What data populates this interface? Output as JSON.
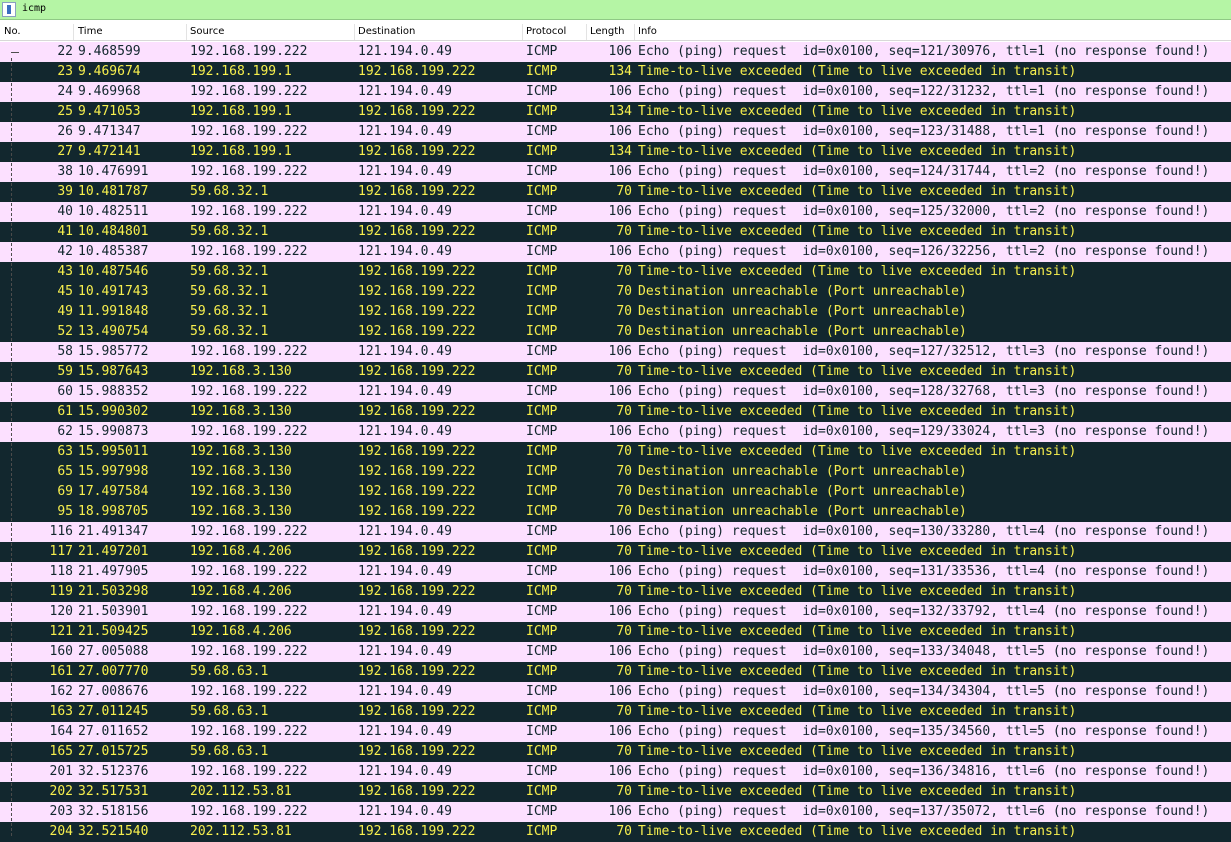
{
  "filter": {
    "value": "icmp"
  },
  "columns": {
    "no": "No.",
    "time": "Time",
    "source": "Source",
    "destination": "Destination",
    "protocol": "Protocol",
    "length": "Length",
    "info": "Info"
  },
  "colors": {
    "request_bg": "#fce0ff",
    "error_bg": "#12272e",
    "error_fg": "#f7ef4e",
    "filter_bg": "#b5f5a5"
  },
  "packets": [
    {
      "no": "22",
      "time": "9.468599",
      "src": "192.168.199.222",
      "dst": "121.194.0.49",
      "proto": "ICMP",
      "len": "106",
      "info": "Echo (ping) request  id=0x0100, seq=121/30976, ttl=1 (no response found!)",
      "kind": "req"
    },
    {
      "no": "23",
      "time": "9.469674",
      "src": "192.168.199.1",
      "dst": "192.168.199.222",
      "proto": "ICMP",
      "len": "134",
      "info": "Time-to-live exceeded (Time to live exceeded in transit)",
      "kind": "err"
    },
    {
      "no": "24",
      "time": "9.469968",
      "src": "192.168.199.222",
      "dst": "121.194.0.49",
      "proto": "ICMP",
      "len": "106",
      "info": "Echo (ping) request  id=0x0100, seq=122/31232, ttl=1 (no response found!)",
      "kind": "req"
    },
    {
      "no": "25",
      "time": "9.471053",
      "src": "192.168.199.1",
      "dst": "192.168.199.222",
      "proto": "ICMP",
      "len": "134",
      "info": "Time-to-live exceeded (Time to live exceeded in transit)",
      "kind": "err"
    },
    {
      "no": "26",
      "time": "9.471347",
      "src": "192.168.199.222",
      "dst": "121.194.0.49",
      "proto": "ICMP",
      "len": "106",
      "info": "Echo (ping) request  id=0x0100, seq=123/31488, ttl=1 (no response found!)",
      "kind": "req"
    },
    {
      "no": "27",
      "time": "9.472141",
      "src": "192.168.199.1",
      "dst": "192.168.199.222",
      "proto": "ICMP",
      "len": "134",
      "info": "Time-to-live exceeded (Time to live exceeded in transit)",
      "kind": "err"
    },
    {
      "no": "38",
      "time": "10.476991",
      "src": "192.168.199.222",
      "dst": "121.194.0.49",
      "proto": "ICMP",
      "len": "106",
      "info": "Echo (ping) request  id=0x0100, seq=124/31744, ttl=2 (no response found!)",
      "kind": "req"
    },
    {
      "no": "39",
      "time": "10.481787",
      "src": "59.68.32.1",
      "dst": "192.168.199.222",
      "proto": "ICMP",
      "len": "70",
      "info": "Time-to-live exceeded (Time to live exceeded in transit)",
      "kind": "err"
    },
    {
      "no": "40",
      "time": "10.482511",
      "src": "192.168.199.222",
      "dst": "121.194.0.49",
      "proto": "ICMP",
      "len": "106",
      "info": "Echo (ping) request  id=0x0100, seq=125/32000, ttl=2 (no response found!)",
      "kind": "req"
    },
    {
      "no": "41",
      "time": "10.484801",
      "src": "59.68.32.1",
      "dst": "192.168.199.222",
      "proto": "ICMP",
      "len": "70",
      "info": "Time-to-live exceeded (Time to live exceeded in transit)",
      "kind": "err"
    },
    {
      "no": "42",
      "time": "10.485387",
      "src": "192.168.199.222",
      "dst": "121.194.0.49",
      "proto": "ICMP",
      "len": "106",
      "info": "Echo (ping) request  id=0x0100, seq=126/32256, ttl=2 (no response found!)",
      "kind": "req"
    },
    {
      "no": "43",
      "time": "10.487546",
      "src": "59.68.32.1",
      "dst": "192.168.199.222",
      "proto": "ICMP",
      "len": "70",
      "info": "Time-to-live exceeded (Time to live exceeded in transit)",
      "kind": "err"
    },
    {
      "no": "45",
      "time": "10.491743",
      "src": "59.68.32.1",
      "dst": "192.168.199.222",
      "proto": "ICMP",
      "len": "70",
      "info": "Destination unreachable (Port unreachable)",
      "kind": "err"
    },
    {
      "no": "49",
      "time": "11.991848",
      "src": "59.68.32.1",
      "dst": "192.168.199.222",
      "proto": "ICMP",
      "len": "70",
      "info": "Destination unreachable (Port unreachable)",
      "kind": "err"
    },
    {
      "no": "52",
      "time": "13.490754",
      "src": "59.68.32.1",
      "dst": "192.168.199.222",
      "proto": "ICMP",
      "len": "70",
      "info": "Destination unreachable (Port unreachable)",
      "kind": "err"
    },
    {
      "no": "58",
      "time": "15.985772",
      "src": "192.168.199.222",
      "dst": "121.194.0.49",
      "proto": "ICMP",
      "len": "106",
      "info": "Echo (ping) request  id=0x0100, seq=127/32512, ttl=3 (no response found!)",
      "kind": "req"
    },
    {
      "no": "59",
      "time": "15.987643",
      "src": "192.168.3.130",
      "dst": "192.168.199.222",
      "proto": "ICMP",
      "len": "70",
      "info": "Time-to-live exceeded (Time to live exceeded in transit)",
      "kind": "err"
    },
    {
      "no": "60",
      "time": "15.988352",
      "src": "192.168.199.222",
      "dst": "121.194.0.49",
      "proto": "ICMP",
      "len": "106",
      "info": "Echo (ping) request  id=0x0100, seq=128/32768, ttl=3 (no response found!)",
      "kind": "req"
    },
    {
      "no": "61",
      "time": "15.990302",
      "src": "192.168.3.130",
      "dst": "192.168.199.222",
      "proto": "ICMP",
      "len": "70",
      "info": "Time-to-live exceeded (Time to live exceeded in transit)",
      "kind": "err"
    },
    {
      "no": "62",
      "time": "15.990873",
      "src": "192.168.199.222",
      "dst": "121.194.0.49",
      "proto": "ICMP",
      "len": "106",
      "info": "Echo (ping) request  id=0x0100, seq=129/33024, ttl=3 (no response found!)",
      "kind": "req"
    },
    {
      "no": "63",
      "time": "15.995011",
      "src": "192.168.3.130",
      "dst": "192.168.199.222",
      "proto": "ICMP",
      "len": "70",
      "info": "Time-to-live exceeded (Time to live exceeded in transit)",
      "kind": "err"
    },
    {
      "no": "65",
      "time": "15.997998",
      "src": "192.168.3.130",
      "dst": "192.168.199.222",
      "proto": "ICMP",
      "len": "70",
      "info": "Destination unreachable (Port unreachable)",
      "kind": "err"
    },
    {
      "no": "69",
      "time": "17.497584",
      "src": "192.168.3.130",
      "dst": "192.168.199.222",
      "proto": "ICMP",
      "len": "70",
      "info": "Destination unreachable (Port unreachable)",
      "kind": "err"
    },
    {
      "no": "95",
      "time": "18.998705",
      "src": "192.168.3.130",
      "dst": "192.168.199.222",
      "proto": "ICMP",
      "len": "70",
      "info": "Destination unreachable (Port unreachable)",
      "kind": "err"
    },
    {
      "no": "116",
      "time": "21.491347",
      "src": "192.168.199.222",
      "dst": "121.194.0.49",
      "proto": "ICMP",
      "len": "106",
      "info": "Echo (ping) request  id=0x0100, seq=130/33280, ttl=4 (no response found!)",
      "kind": "req"
    },
    {
      "no": "117",
      "time": "21.497201",
      "src": "192.168.4.206",
      "dst": "192.168.199.222",
      "proto": "ICMP",
      "len": "70",
      "info": "Time-to-live exceeded (Time to live exceeded in transit)",
      "kind": "err"
    },
    {
      "no": "118",
      "time": "21.497905",
      "src": "192.168.199.222",
      "dst": "121.194.0.49",
      "proto": "ICMP",
      "len": "106",
      "info": "Echo (ping) request  id=0x0100, seq=131/33536, ttl=4 (no response found!)",
      "kind": "req"
    },
    {
      "no": "119",
      "time": "21.503298",
      "src": "192.168.4.206",
      "dst": "192.168.199.222",
      "proto": "ICMP",
      "len": "70",
      "info": "Time-to-live exceeded (Time to live exceeded in transit)",
      "kind": "err"
    },
    {
      "no": "120",
      "time": "21.503901",
      "src": "192.168.199.222",
      "dst": "121.194.0.49",
      "proto": "ICMP",
      "len": "106",
      "info": "Echo (ping) request  id=0x0100, seq=132/33792, ttl=4 (no response found!)",
      "kind": "req"
    },
    {
      "no": "121",
      "time": "21.509425",
      "src": "192.168.4.206",
      "dst": "192.168.199.222",
      "proto": "ICMP",
      "len": "70",
      "info": "Time-to-live exceeded (Time to live exceeded in transit)",
      "kind": "err"
    },
    {
      "no": "160",
      "time": "27.005088",
      "src": "192.168.199.222",
      "dst": "121.194.0.49",
      "proto": "ICMP",
      "len": "106",
      "info": "Echo (ping) request  id=0x0100, seq=133/34048, ttl=5 (no response found!)",
      "kind": "req"
    },
    {
      "no": "161",
      "time": "27.007770",
      "src": "59.68.63.1",
      "dst": "192.168.199.222",
      "proto": "ICMP",
      "len": "70",
      "info": "Time-to-live exceeded (Time to live exceeded in transit)",
      "kind": "err"
    },
    {
      "no": "162",
      "time": "27.008676",
      "src": "192.168.199.222",
      "dst": "121.194.0.49",
      "proto": "ICMP",
      "len": "106",
      "info": "Echo (ping) request  id=0x0100, seq=134/34304, ttl=5 (no response found!)",
      "kind": "req"
    },
    {
      "no": "163",
      "time": "27.011245",
      "src": "59.68.63.1",
      "dst": "192.168.199.222",
      "proto": "ICMP",
      "len": "70",
      "info": "Time-to-live exceeded (Time to live exceeded in transit)",
      "kind": "err"
    },
    {
      "no": "164",
      "time": "27.011652",
      "src": "192.168.199.222",
      "dst": "121.194.0.49",
      "proto": "ICMP",
      "len": "106",
      "info": "Echo (ping) request  id=0x0100, seq=135/34560, ttl=5 (no response found!)",
      "kind": "req"
    },
    {
      "no": "165",
      "time": "27.015725",
      "src": "59.68.63.1",
      "dst": "192.168.199.222",
      "proto": "ICMP",
      "len": "70",
      "info": "Time-to-live exceeded (Time to live exceeded in transit)",
      "kind": "err"
    },
    {
      "no": "201",
      "time": "32.512376",
      "src": "192.168.199.222",
      "dst": "121.194.0.49",
      "proto": "ICMP",
      "len": "106",
      "info": "Echo (ping) request  id=0x0100, seq=136/34816, ttl=6 (no response found!)",
      "kind": "req"
    },
    {
      "no": "202",
      "time": "32.517531",
      "src": "202.112.53.81",
      "dst": "192.168.199.222",
      "proto": "ICMP",
      "len": "70",
      "info": "Time-to-live exceeded (Time to live exceeded in transit)",
      "kind": "err"
    },
    {
      "no": "203",
      "time": "32.518156",
      "src": "192.168.199.222",
      "dst": "121.194.0.49",
      "proto": "ICMP",
      "len": "106",
      "info": "Echo (ping) request  id=0x0100, seq=137/35072, ttl=6 (no response found!)",
      "kind": "req"
    },
    {
      "no": "204",
      "time": "32.521540",
      "src": "202.112.53.81",
      "dst": "192.168.199.222",
      "proto": "ICMP",
      "len": "70",
      "info": "Time-to-live exceeded (Time to live exceeded in transit)",
      "kind": "err"
    }
  ]
}
